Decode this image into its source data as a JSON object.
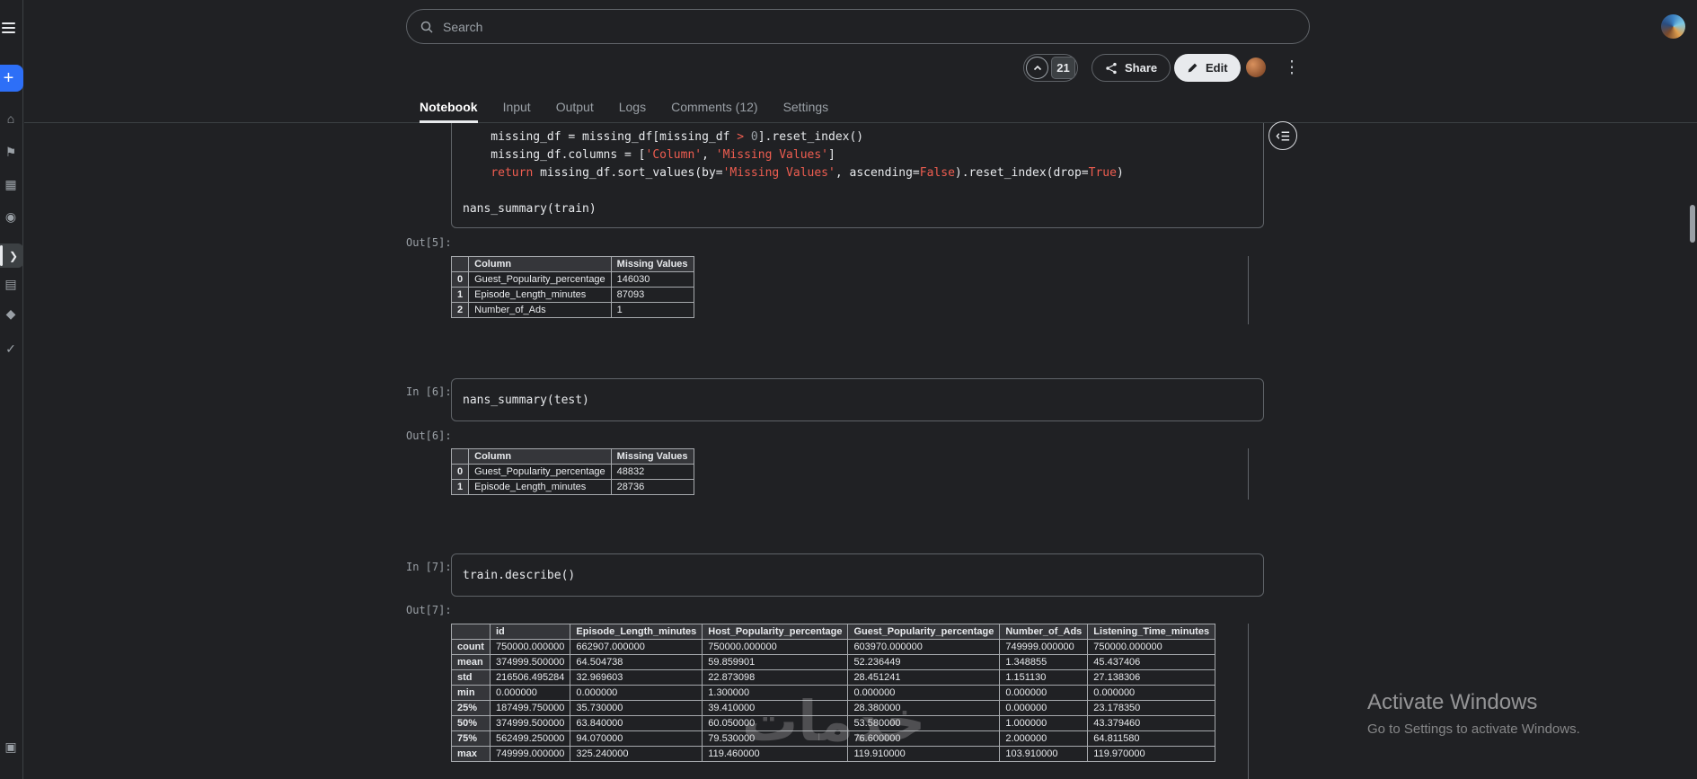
{
  "topbar": {
    "search_placeholder": "Search"
  },
  "actions": {
    "upvotes": "21",
    "share_label": "Share",
    "edit_label": "Edit"
  },
  "tabs": {
    "items": [
      "Notebook",
      "Input",
      "Output",
      "Logs",
      "Comments (12)",
      "Settings"
    ],
    "active": "Notebook"
  },
  "sidebar": {
    "create_glyph": "+",
    "expand_glyph": "❯",
    "bottom_glyph": "▣",
    "icons": [
      {
        "label": "home",
        "glyph": "⌂"
      },
      {
        "label": "competitions",
        "glyph": "⚑"
      },
      {
        "label": "datasets",
        "glyph": "▦"
      },
      {
        "label": "models",
        "glyph": "◉"
      },
      {
        "label": "discussions",
        "glyph": "▤"
      },
      {
        "label": "learn",
        "glyph": "◆"
      },
      {
        "label": "more",
        "glyph": "✓"
      }
    ]
  },
  "notebook": {
    "cell_partial": {
      "lines": [
        [
          {
            "t": "    missing_df = missing_df[missing_df "
          },
          {
            "t": ">",
            "c": "hl"
          },
          {
            "t": " "
          },
          {
            "t": "0",
            "c": "n"
          },
          {
            "t": "].reset_index()"
          }
        ],
        [
          {
            "t": "    missing_df.columns = ["
          },
          {
            "t": "'Column'",
            "c": "hl"
          },
          {
            "t": ", "
          },
          {
            "t": "'Missing Values'",
            "c": "hl"
          },
          {
            "t": "]"
          }
        ],
        [
          {
            "t": "    "
          },
          {
            "t": "return",
            "c": "hl"
          },
          {
            "t": " missing_df.sort_values(by="
          },
          {
            "t": "'Missing Values'",
            "c": "hl"
          },
          {
            "t": ", ascending="
          },
          {
            "t": "False",
            "c": "hl"
          },
          {
            "t": ").reset_index(drop="
          },
          {
            "t": "True",
            "c": "hl"
          },
          {
            "t": ")"
          }
        ],
        [
          {
            "t": ""
          }
        ],
        [
          {
            "t": "nans_summary(train)"
          }
        ]
      ]
    },
    "out5": {
      "label": "Out[5]:",
      "table": {
        "columns": [
          "",
          "Column",
          "Missing Values"
        ],
        "rows": [
          [
            "0",
            "Guest_Popularity_percentage",
            "146030"
          ],
          [
            "1",
            "Episode_Length_minutes",
            "87093"
          ],
          [
            "2",
            "Number_of_Ads",
            "1"
          ]
        ]
      }
    },
    "in6": {
      "label": "In [6]:",
      "code": "nans_summary(test)"
    },
    "out6": {
      "label": "Out[6]:",
      "table": {
        "columns": [
          "",
          "Column",
          "Missing Values"
        ],
        "rows": [
          [
            "0",
            "Guest_Popularity_percentage",
            "48832"
          ],
          [
            "1",
            "Episode_Length_minutes",
            "28736"
          ]
        ]
      }
    },
    "in7": {
      "label": "In [7]:",
      "code": "train.describe()"
    },
    "out7": {
      "label": "Out[7]:",
      "table": {
        "columns": [
          "",
          "id",
          "Episode_Length_minutes",
          "Host_Popularity_percentage",
          "Guest_Popularity_percentage",
          "Number_of_Ads",
          "Listening_Time_minutes"
        ],
        "rows": [
          [
            "count",
            "750000.000000",
            "662907.000000",
            "750000.000000",
            "603970.000000",
            "749999.000000",
            "750000.000000"
          ],
          [
            "mean",
            "374999.500000",
            "64.504738",
            "59.859901",
            "52.236449",
            "1.348855",
            "45.437406"
          ],
          [
            "std",
            "216506.495284",
            "32.969603",
            "22.873098",
            "28.451241",
            "1.151130",
            "27.138306"
          ],
          [
            "min",
            "0.000000",
            "0.000000",
            "1.300000",
            "0.000000",
            "0.000000",
            "0.000000"
          ],
          [
            "25%",
            "187499.750000",
            "35.730000",
            "39.410000",
            "28.380000",
            "0.000000",
            "23.178350"
          ],
          [
            "50%",
            "374999.500000",
            "63.840000",
            "60.050000",
            "53.580000",
            "1.000000",
            "43.379460"
          ],
          [
            "75%",
            "562499.250000",
            "94.070000",
            "79.530000",
            "76.600000",
            "2.000000",
            "64.811580"
          ],
          [
            "max",
            "749999.000000",
            "325.240000",
            "119.460000",
            "119.910000",
            "103.910000",
            "119.970000"
          ]
        ]
      }
    }
  },
  "watermark": "خدمات",
  "activate": {
    "title": "Activate Windows",
    "subtitle": "Go to Settings to activate Windows."
  },
  "colors": {
    "accent_blue": "#2d6ff7",
    "bronze": "#b87748",
    "highlight_red": "#ee5d50"
  }
}
